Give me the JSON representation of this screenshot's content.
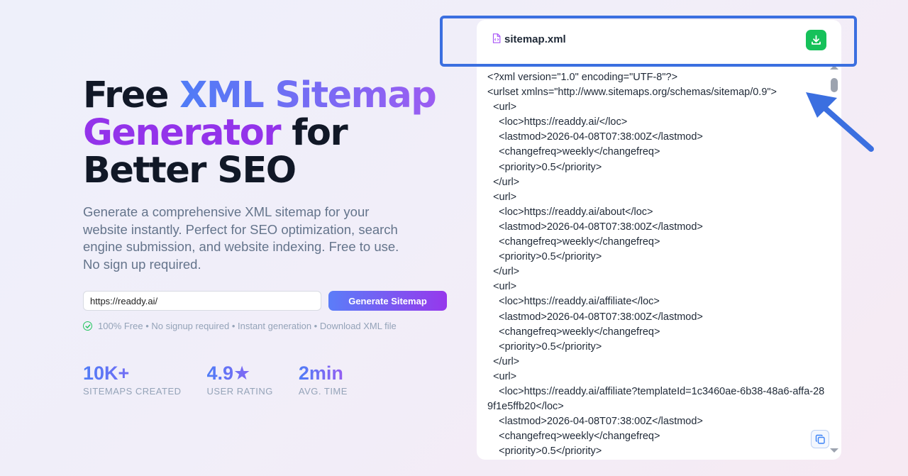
{
  "hero": {
    "title_part1": "Free ",
    "title_part2": "XML Sitemap",
    "title_part3": "Generator",
    "title_part4": " for",
    "title_part5": "Better SEO",
    "description": "Generate a comprehensive XML sitemap for your website instantly. Perfect for SEO optimization, search engine submission, and website indexing. Free to use. No sign up required."
  },
  "form": {
    "url_value": "https://readdy.ai/",
    "generate_label": "Generate Sitemap"
  },
  "note": "100% Free • No signup required • Instant generation • Download XML file",
  "stats": [
    {
      "value": "10K+",
      "label": "SITEMAPS CREATED"
    },
    {
      "value": "4.9★",
      "label": "USER RATING"
    },
    {
      "value": "2min",
      "label": "AVG. TIME"
    }
  ],
  "file": {
    "name": "sitemap.xml",
    "content": "<?xml version=\"1.0\" encoding=\"UTF-8\"?>\n<urlset xmlns=\"http://www.sitemaps.org/schemas/sitemap/0.9\">\n  <url>\n    <loc>https://readdy.ai/</loc>\n    <lastmod>2026-04-08T07:38:00Z</lastmod>\n    <changefreq>weekly</changefreq>\n    <priority>0.5</priority>\n  </url>\n  <url>\n    <loc>https://readdy.ai/about</loc>\n    <lastmod>2026-04-08T07:38:00Z</lastmod>\n    <changefreq>weekly</changefreq>\n    <priority>0.5</priority>\n  </url>\n  <url>\n    <loc>https://readdy.ai/affiliate</loc>\n    <lastmod>2026-04-08T07:38:00Z</lastmod>\n    <changefreq>weekly</changefreq>\n    <priority>0.5</priority>\n  </url>\n  <url>\n    <loc>https://readdy.ai/affiliate?templateId=1c3460ae-6b38-48a6-affa-289f1e5ffb20</loc>\n    <lastmod>2026-04-08T07:38:00Z</lastmod>\n    <changefreq>weekly</changefreq>\n    <priority>0.5</priority>"
  },
  "icons": {
    "file": "file-code-icon",
    "download": "download-icon",
    "copy": "copy-icon",
    "check": "check-circle-icon"
  },
  "colors": {
    "accent_blue": "#3b82f6",
    "accent_purple": "#9333ea",
    "download_green": "#16c15a",
    "annotation_blue": "#3b6fe0"
  }
}
